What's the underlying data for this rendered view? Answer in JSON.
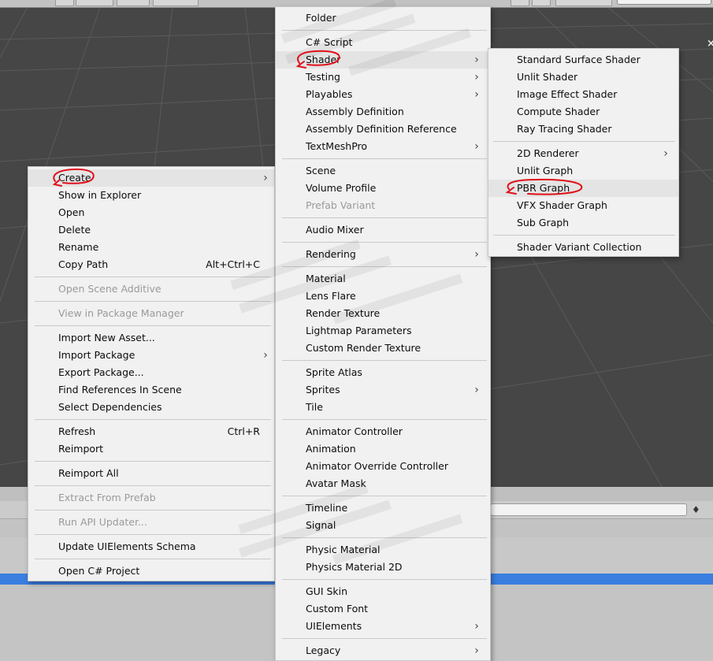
{
  "context_menu": {
    "items": [
      {
        "label": "Create",
        "submenu": true,
        "highlighted": true
      },
      {
        "label": "Show in Explorer"
      },
      {
        "label": "Open"
      },
      {
        "label": "Delete"
      },
      {
        "label": "Rename"
      },
      {
        "label": "Copy Path",
        "shortcut": "Alt+Ctrl+C"
      },
      {
        "separator": true
      },
      {
        "label": "Open Scene Additive",
        "disabled": true
      },
      {
        "separator": true
      },
      {
        "label": "View in Package Manager",
        "disabled": true
      },
      {
        "separator": true
      },
      {
        "label": "Import New Asset..."
      },
      {
        "label": "Import Package",
        "submenu": true
      },
      {
        "label": "Export Package..."
      },
      {
        "label": "Find References In Scene"
      },
      {
        "label": "Select Dependencies"
      },
      {
        "separator": true
      },
      {
        "label": "Refresh",
        "shortcut": "Ctrl+R"
      },
      {
        "label": "Reimport"
      },
      {
        "separator": true
      },
      {
        "label": "Reimport All"
      },
      {
        "separator": true
      },
      {
        "label": "Extract From Prefab",
        "disabled": true
      },
      {
        "separator": true
      },
      {
        "label": "Run API Updater...",
        "disabled": true
      },
      {
        "separator": true
      },
      {
        "label": "Update UIElements Schema"
      },
      {
        "separator": true
      },
      {
        "label": "Open C# Project"
      }
    ]
  },
  "create_menu": {
    "items": [
      {
        "label": "Folder"
      },
      {
        "separator": true
      },
      {
        "label": "C# Script"
      },
      {
        "label": "Shader",
        "submenu": true,
        "highlighted": true
      },
      {
        "label": "Testing",
        "submenu": true
      },
      {
        "label": "Playables",
        "submenu": true
      },
      {
        "label": "Assembly Definition"
      },
      {
        "label": "Assembly Definition Reference"
      },
      {
        "label": "TextMeshPro",
        "submenu": true
      },
      {
        "separator": true
      },
      {
        "label": "Scene"
      },
      {
        "label": "Volume Profile"
      },
      {
        "label": "Prefab Variant",
        "disabled": true
      },
      {
        "separator": true
      },
      {
        "label": "Audio Mixer"
      },
      {
        "separator": true
      },
      {
        "label": "Rendering",
        "submenu": true
      },
      {
        "separator": true
      },
      {
        "label": "Material"
      },
      {
        "label": "Lens Flare"
      },
      {
        "label": "Render Texture"
      },
      {
        "label": "Lightmap Parameters"
      },
      {
        "label": "Custom Render Texture"
      },
      {
        "separator": true
      },
      {
        "label": "Sprite Atlas"
      },
      {
        "label": "Sprites",
        "submenu": true
      },
      {
        "label": "Tile"
      },
      {
        "separator": true
      },
      {
        "label": "Animator Controller"
      },
      {
        "label": "Animation"
      },
      {
        "label": "Animator Override Controller"
      },
      {
        "label": "Avatar Mask"
      },
      {
        "separator": true
      },
      {
        "label": "Timeline"
      },
      {
        "label": "Signal"
      },
      {
        "separator": true
      },
      {
        "label": "Physic Material"
      },
      {
        "label": "Physics Material 2D"
      },
      {
        "separator": true
      },
      {
        "label": "GUI Skin"
      },
      {
        "label": "Custom Font"
      },
      {
        "label": "UIElements",
        "submenu": true
      },
      {
        "separator": true
      },
      {
        "label": "Legacy",
        "submenu": true
      }
    ]
  },
  "shader_menu": {
    "items": [
      {
        "label": "Standard Surface Shader"
      },
      {
        "label": "Unlit Shader"
      },
      {
        "label": "Image Effect Shader"
      },
      {
        "label": "Compute Shader"
      },
      {
        "label": "Ray Tracing Shader"
      },
      {
        "separator": true
      },
      {
        "label": "2D Renderer",
        "submenu": true
      },
      {
        "label": "Unlit Graph"
      },
      {
        "label": "PBR Graph",
        "highlighted": true
      },
      {
        "label": "VFX Shader Graph"
      },
      {
        "label": "Sub Graph"
      },
      {
        "separator": true
      },
      {
        "label": "Shader Variant Collection"
      }
    ]
  },
  "icons": {
    "submenu_arrow": "chevron-right-icon",
    "close": "close-icon",
    "scene_tool": "scene-tools-icon"
  },
  "glyphs": {
    "arrow": "›",
    "close": "×",
    "tool": "♦"
  },
  "colors": {
    "menu_bg": "#f1f1f1",
    "highlight": "#e4e4e4",
    "disabled_text": "#9a9a9a",
    "annotation_red": "#e0101a",
    "scene_bg": "#464646",
    "selection_blue": "#3a7ee0"
  }
}
